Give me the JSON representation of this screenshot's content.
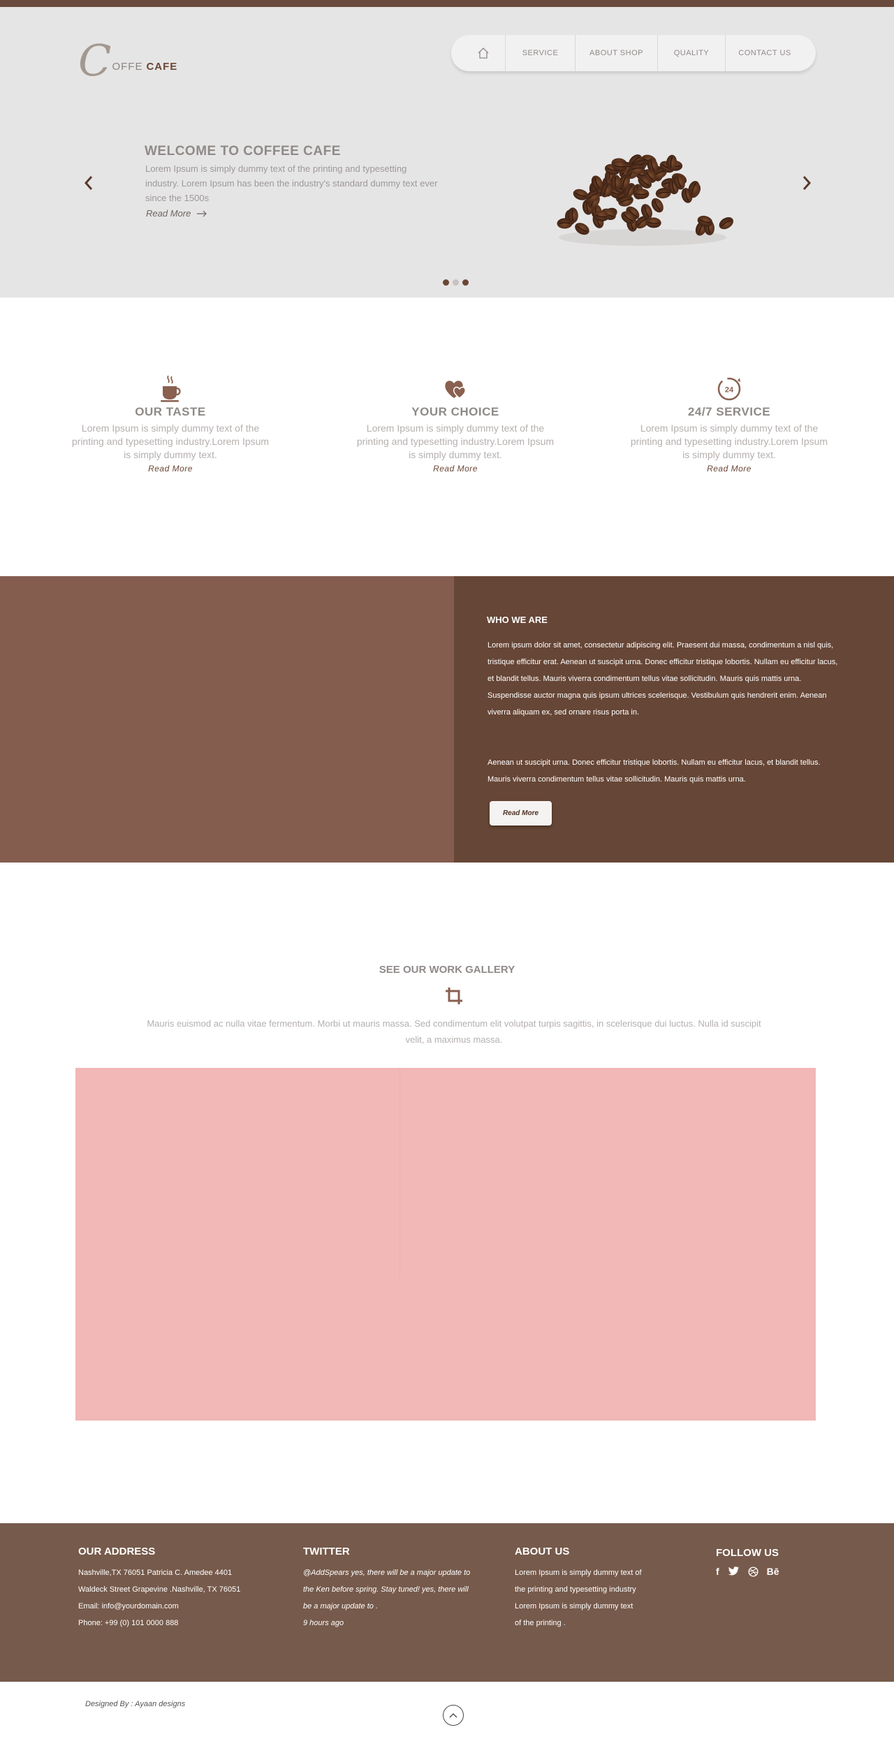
{
  "brand": {
    "letter": "C",
    "word1": "OFFE",
    "word2": "CAFE"
  },
  "nav": {
    "home_icon": "home-icon",
    "items": [
      {
        "label": "SERVICE"
      },
      {
        "label": "ABOUT SHOP"
      },
      {
        "label": "QUALITY"
      },
      {
        "label": "CONTACT US"
      }
    ]
  },
  "hero": {
    "title": "WELCOME TO COFFEE CAFE",
    "text": "Lorem Ipsum is simply dummy text of the printing and typesetting industry. Lorem Ipsum has been the industry's standard dummy text ever since the 1500s",
    "read_more": "Read More",
    "prev_icon": "chevron-left-icon",
    "next_icon": "chevron-right-icon",
    "slides": 3,
    "active_slide": 1
  },
  "features": [
    {
      "icon": "coffee-cup-icon",
      "title": "OUR TASTE",
      "text": "Lorem Ipsum is simply dummy text of the printing and typesetting industry.Lorem Ipsum is simply dummy text.",
      "link": "Read More"
    },
    {
      "icon": "heart-icon",
      "title": "YOUR CHOICE",
      "text": "Lorem Ipsum is simply dummy text of the printing and typesetting industry.Lorem Ipsum is simply dummy text.",
      "link": "Read More"
    },
    {
      "icon": "24-hours-icon",
      "title": "24/7 SERVICE",
      "text": "Lorem Ipsum is simply dummy text of the printing and typesetting industry.Lorem Ipsum is simply dummy text.",
      "link": "Read More"
    }
  ],
  "about": {
    "title": "WHO WE ARE",
    "p1": "Lorem ipsum dolor sit amet, consectetur adipiscing elit. Praesent dui massa, condimentum a nisl quis, tristique efficitur erat. Aenean ut suscipit urna. Donec efficitur tristique lobortis. Nullam eu efficitur lacus, et blandit tellus. Mauris viverra condimentum tellus vitae sollicitudin. Mauris quis mattis urna. Suspendisse auctor magna quis ipsum ultrices scelerisque. Vestibulum quis hendrerit enim. Aenean viverra aliquam ex, sed ornare risus porta in.",
    "p2": "Aenean ut suscipit urna. Donec efficitur tristique lobortis. Nullam eu efficitur lacus, et blandit tellus. Mauris viverra condimentum tellus vitae sollicitudin. Mauris quis mattis urna.",
    "button": "Read More"
  },
  "gallery": {
    "title": "SEE OUR WORK GALLERY",
    "icon": "crop-icon",
    "text": "Mauris euismod ac nulla vitae fermentum. Morbi ut mauris massa. Sed condimentum elit volutpat turpis sagittis, in scelerisque dui luctus. Nulla id suscipit velit, a maximus massa."
  },
  "footer": {
    "address": {
      "title": "OUR ADDRESS",
      "lines": [
        "Nashville,TX 76051 Patricia C. Amedee 4401",
        "Waldeck Street Grapevine .Nashville, TX 76051",
        "Email: info@yourdomain.com",
        "Phone: +99 (0) 101 0000 888"
      ]
    },
    "twitter": {
      "title": "TWITTER",
      "lines": [
        "@AddSpears yes, there will be a major update to",
        "the Ken before spring. Stay tuned! yes, there will",
        "be a major update to .",
        "9 hours ago"
      ]
    },
    "about": {
      "title": "ABOUT US",
      "lines": [
        "Lorem Ipsum is simply dummy text of",
        "the printing and typesetting industry",
        "Lorem Ipsum is simply dummy text",
        "of the printing ."
      ]
    },
    "follow": {
      "title": "FOLLOW US",
      "icons": [
        "facebook-icon",
        "twitter-icon",
        "dribbble-icon",
        "behance-icon"
      ],
      "facebook_glyph": "f",
      "behance_glyph": "Bē"
    },
    "credit": "Designed By : Ayaan designs",
    "to_top_icon": "chevron-up-icon"
  },
  "colors": {
    "brown_dark": "#664636",
    "brown_mid": "#845d4f",
    "footer_bg": "#765a4b",
    "hero_bg": "#e6e5e5",
    "gallery_bg": "#f2b7b7",
    "accent": "#6b4636"
  }
}
